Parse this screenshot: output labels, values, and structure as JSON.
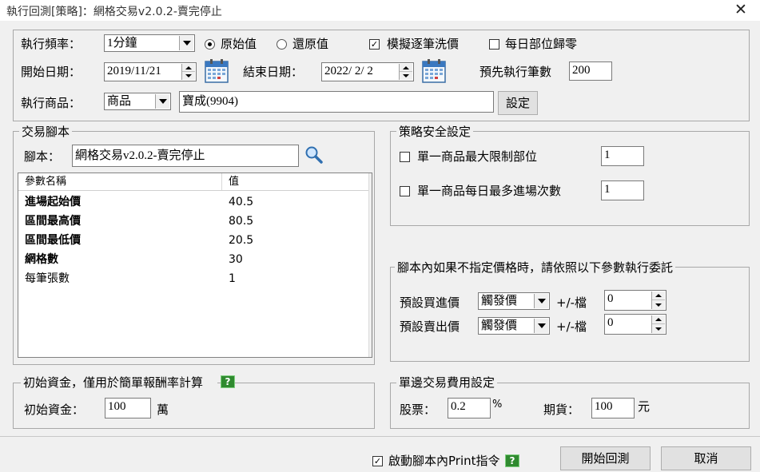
{
  "window": {
    "title": "執行回測[策略]：網格交易v2.0.2-賣完停止"
  },
  "top": {
    "freq_label": "執行頻率：",
    "freq_value": "1分鐘",
    "radio_original": "原始值",
    "radio_restore": "還原值",
    "simulate_label": "模擬逐筆洗價",
    "daily_reset_label": "每日部位歸零",
    "start_label": "開始日期：",
    "start_value": "2019/11/21",
    "end_label": "結束日期：",
    "end_value": "2022/ 2/ 2",
    "preload_label": "預先執行筆數",
    "preload_value": "200",
    "product_label": "執行商品：",
    "product_type": "商品",
    "product_value": "寶成(9904)",
    "settings_button": "設定"
  },
  "script": {
    "group_title": "交易腳本",
    "script_label": "腳本：",
    "script_value": "網格交易v2.0.2-賣完停止",
    "columns": [
      "參數名稱",
      "值"
    ],
    "rows": [
      {
        "name": "進場起始價",
        "value": "40.5"
      },
      {
        "name": "區間最高價",
        "value": "80.5"
      },
      {
        "name": "區間最低價",
        "value": "20.5"
      },
      {
        "name": "網格數",
        "value": "30"
      },
      {
        "name": "每筆張數",
        "value": "1"
      }
    ]
  },
  "safety": {
    "group_title": "策略安全設定",
    "max_position_label": "單一商品最大限制部位",
    "max_position_value": "1",
    "max_entries_label": "單一商品每日最多進場次數",
    "max_entries_value": "1"
  },
  "price": {
    "group_title": "腳本內如果不指定價格時，請依照以下參數執行委託",
    "buy_label": "預設買進價",
    "buy_value": "觸發價",
    "buy_tick_label": "+/-檔",
    "buy_tick_value": "0",
    "sell_label": "預設賣出價",
    "sell_value": "觸發價",
    "sell_tick_label": "+/-檔",
    "sell_tick_value": "0"
  },
  "capital": {
    "group_title": "初始資金，僅用於簡單報酬率計算",
    "label": "初始資金：",
    "value": "100",
    "unit": "萬"
  },
  "fees": {
    "group_title": "單邊交易費用設定",
    "stock_label": "股票：",
    "stock_value": "0.2",
    "stock_unit": "%",
    "futures_label": "期貨：",
    "futures_value": "100",
    "futures_unit": "元"
  },
  "footer": {
    "print_label": "啟動腳本內Print指令",
    "start_button": "開始回測",
    "cancel_button": "取消"
  },
  "icons": {
    "help": "?",
    "check": "✓",
    "close": "✕"
  }
}
